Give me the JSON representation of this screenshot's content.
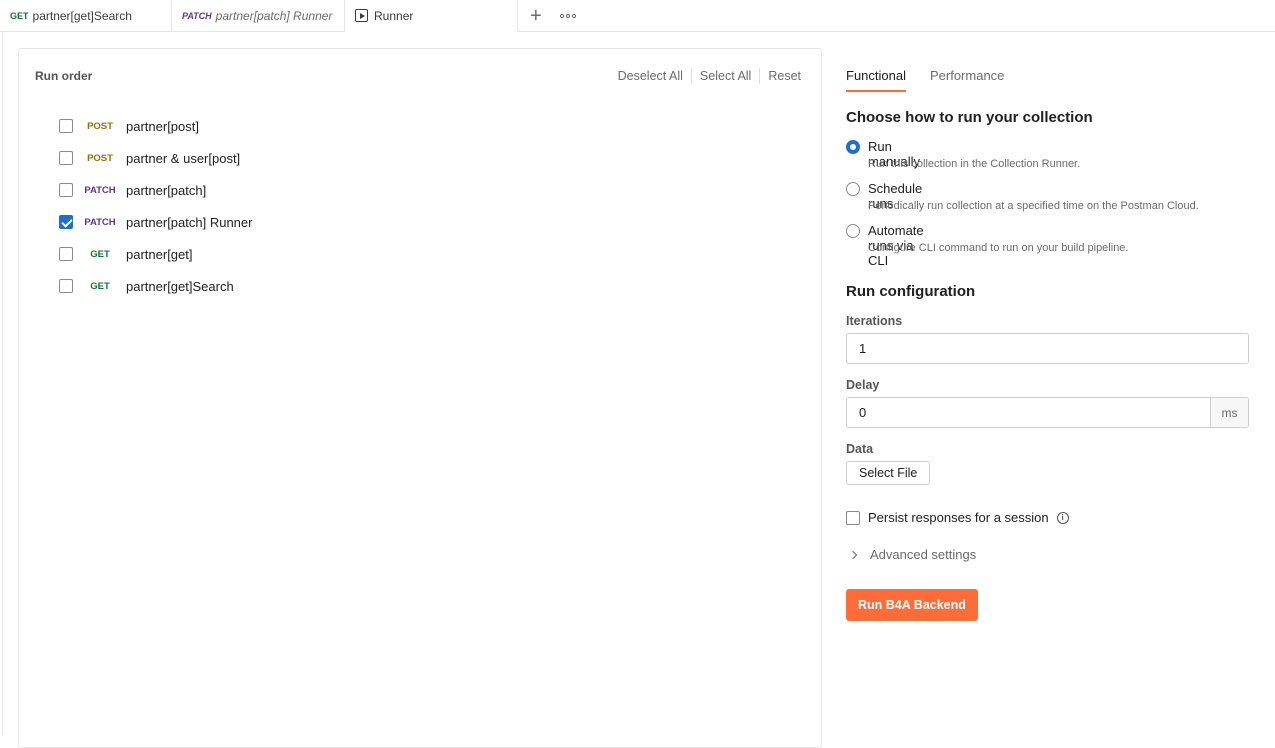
{
  "tabs": [
    {
      "method": "GET",
      "label": "partner[get]Search"
    },
    {
      "method": "PATCH",
      "label": "partner[patch] Runner"
    },
    {
      "label": "Runner"
    }
  ],
  "run_order": {
    "title": "Run order",
    "actions": {
      "deselect_all": "Deselect All",
      "select_all": "Select All",
      "reset": "Reset"
    },
    "requests": [
      {
        "method": "POST",
        "name": "partner[post]",
        "checked": false
      },
      {
        "method": "POST",
        "name": "partner & user[post]",
        "checked": false
      },
      {
        "method": "PATCH",
        "name": "partner[patch]",
        "checked": false
      },
      {
        "method": "PATCH",
        "name": "partner[patch] Runner",
        "checked": true
      },
      {
        "method": "GET",
        "name": "partner[get]",
        "checked": false
      },
      {
        "method": "GET",
        "name": "partner[get]Search",
        "checked": false
      }
    ]
  },
  "config": {
    "tabs": {
      "functional": "Functional",
      "performance": "Performance"
    },
    "choose_title": "Choose how to run your collection",
    "options": [
      {
        "label": "Run manually",
        "desc": "Run this collection in the Collection Runner."
      },
      {
        "label": "Schedule runs",
        "desc": "Periodically run collection at a specified time on the Postman Cloud."
      },
      {
        "label": "Automate runs via CLI",
        "desc": "Configure CLI command to run on your build pipeline."
      }
    ],
    "run_config_title": "Run configuration",
    "iterations_label": "Iterations",
    "iterations_value": "1",
    "delay_label": "Delay",
    "delay_value": "0",
    "delay_unit": "ms",
    "data_label": "Data",
    "select_file": "Select File",
    "persist_label": "Persist responses for a session",
    "advanced_label": "Advanced settings",
    "run_button": "Run B4A Backend"
  },
  "colors": {
    "accent": "#ff6c37",
    "checkbox": "#1a6fd6"
  }
}
